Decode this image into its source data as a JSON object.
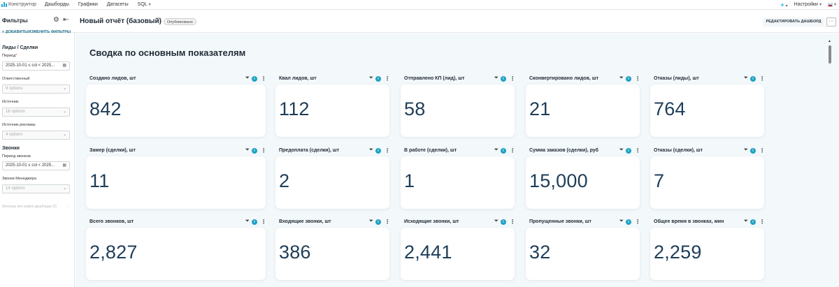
{
  "topnav": {
    "brand": "Конструктор",
    "items": [
      "Дашборды",
      "Графики",
      "Датасеты",
      "SQL"
    ],
    "settings": "Настройки"
  },
  "header": {
    "filters_title": "Фильтры",
    "report_title": "Новый отчёт (базовый)",
    "status_badge": "Опубликовано",
    "edit_button": "РЕДАКТИРОВАТЬ ДАШБОРД",
    "more_button": "···"
  },
  "sidebar": {
    "add_filter": "+ ДОБАВИТЬ/ИЗМЕНИТЬ ФИЛЬТРЫ",
    "section_leads": "Лиды / Сделки",
    "period_label": "Период",
    "period_value": "2025-10-01 ≤ col < 2025...",
    "responsible_label": "Ответственный",
    "responsible_placeholder": "9 options",
    "source_label": "Источник",
    "source_placeholder": "16 options",
    "ad_source_label": "Источник рекламы",
    "ad_source_placeholder": "4 options",
    "section_calls": "Звонки",
    "calls_period_label": "Период звонков",
    "calls_period_value": "2025-10-01 ≤ col < 2025...",
    "manager_calls_label": "Звонки Менеджера",
    "manager_calls_placeholder": "14 options",
    "hidden_filters_note": "Фильтры вне рамок дашборда (0)"
  },
  "main": {
    "title": "Сводка по основным показателям",
    "info_glyph": "i",
    "rows": [
      [
        {
          "title": "Создано лидов, шт",
          "value": "842"
        },
        {
          "title": "Квал лидов, шт",
          "value": "112"
        },
        {
          "title": "Отправлено КП (лид), шт",
          "value": "58"
        },
        {
          "title": "Сконвертировано лидов, шт",
          "value": "21"
        },
        {
          "title": "Отказы (лиды), шт",
          "value": "764"
        }
      ],
      [
        {
          "title": "Замер (сделки), шт",
          "value": "11"
        },
        {
          "title": "Предоплата (сделки), шт",
          "value": "2"
        },
        {
          "title": "В работе (сделки), шт",
          "value": "1"
        },
        {
          "title": "Сумма заказов (сделки), руб",
          "value": "15,000"
        },
        {
          "title": "Отказы (сделки), шт",
          "value": "7"
        }
      ],
      [
        {
          "title": "Всего звонков, шт",
          "value": "2,827"
        },
        {
          "title": "Входящие звонки, шт",
          "value": "386"
        },
        {
          "title": "Исходящие звонки, шт",
          "value": "2,441"
        },
        {
          "title": "Пропущенные звонки, шт",
          "value": "32"
        },
        {
          "title": "Общее время в звонках, мин",
          "value": "2,259"
        }
      ]
    ]
  }
}
